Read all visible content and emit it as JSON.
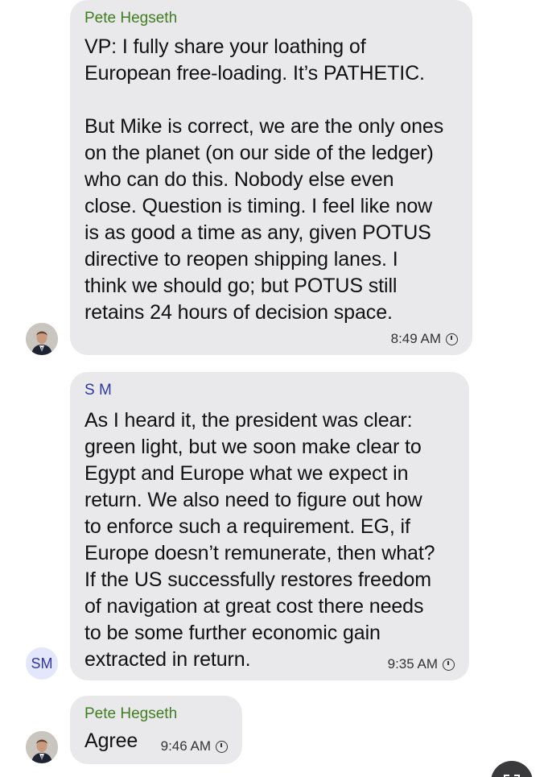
{
  "colors": {
    "bubble_bg": "#e9e9eb",
    "sender_pete": "#3f7d1f",
    "sender_sm": "#2f3a9c",
    "text": "#111111",
    "avatar_initials_bg": "#e4e6fb"
  },
  "messages": [
    {
      "sender": "Pete Hegseth",
      "text": "VP: I fully share your loathing of\nEuropean free-loading. It’s PATHETIC.\n\nBut Mike is correct, we are the only ones\non the planet (on our side of the ledger)\nwho can do this. Nobody else even\nclose. Question is timing. I feel like now\nis as good a time as any, given POTUS\ndirective to reopen shipping lanes. I\nthink we should go; but POTUS still\nretains 24 hours of decision space.",
      "time": "8:49 AM",
      "avatar": "pete-photo"
    },
    {
      "sender": "S M",
      "text": "As I heard it, the president was clear:\ngreen light, but we soon make clear to\nEgypt and Europe what we expect in\nreturn. We also need to figure out how\nto enforce such a requirement. EG, if\nEurope doesn’t remunerate, then what?\nIf the US successfully restores freedom\nof navigation at great cost there needs\nto be some further economic gain\nextracted in return.",
      "time": "9:35 AM",
      "avatar_initials": "SM"
    },
    {
      "sender": "Pete Hegseth",
      "text": "Agree",
      "time": "9:46 AM",
      "avatar": "pete-photo"
    }
  ]
}
